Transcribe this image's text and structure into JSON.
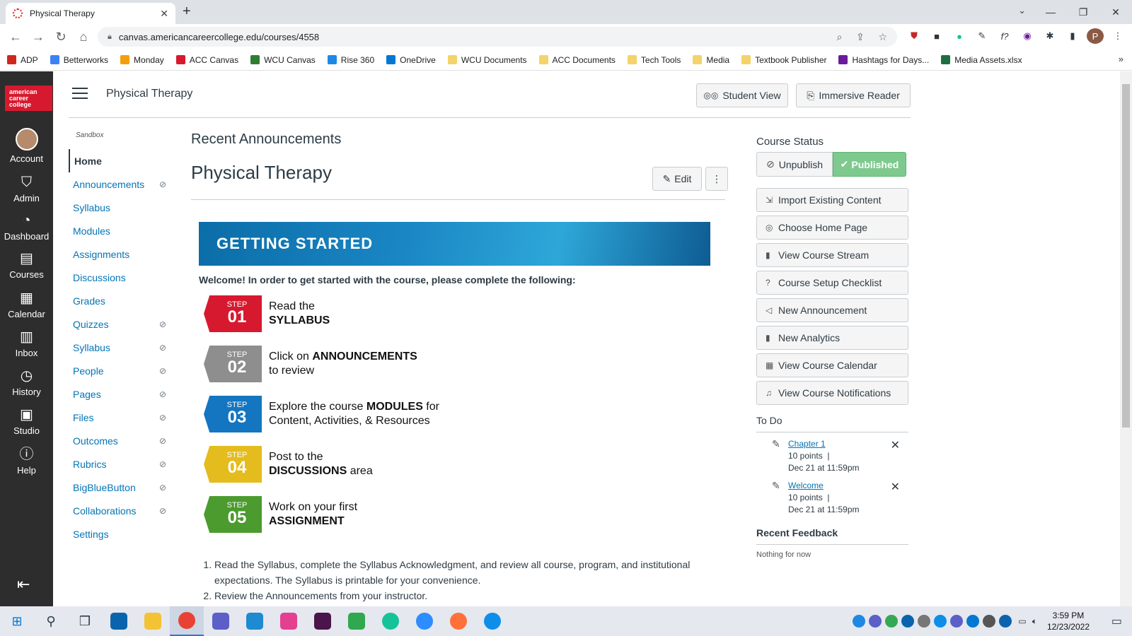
{
  "browser": {
    "tab_title": "Physical Therapy",
    "url": "canvas.americancareercollege.edu/courses/4558",
    "profile_initial": "P",
    "bookmarks": [
      {
        "label": "ADP",
        "color": "#d0271d"
      },
      {
        "label": "Betterworks",
        "color": "#3b82f6"
      },
      {
        "label": "Monday",
        "color": "#f59e0b"
      },
      {
        "label": "ACC Canvas",
        "color": "#d7192f"
      },
      {
        "label": "WCU Canvas",
        "color": "#2e7d32"
      },
      {
        "label": "Rise 360",
        "color": "#1e88e5"
      },
      {
        "label": "OneDrive",
        "color": "#0078d4"
      },
      {
        "label": "WCU Documents",
        "color": "#f3d36a"
      },
      {
        "label": "ACC Documents",
        "color": "#f3d36a"
      },
      {
        "label": "Tech Tools",
        "color": "#f3d36a"
      },
      {
        "label": "Media",
        "color": "#f3d36a"
      },
      {
        "label": "Textbook Publisher",
        "color": "#f3d36a"
      },
      {
        "label": "Hashtags for Days...",
        "color": "#6a1b9a"
      },
      {
        "label": "Media Assets.xlsx",
        "color": "#1d6f42"
      }
    ]
  },
  "global_nav": {
    "logo": "american career college",
    "items": [
      {
        "label": "Account",
        "icon": "avatar"
      },
      {
        "label": "Admin",
        "icon": "shield-icon"
      },
      {
        "label": "Dashboard",
        "icon": "dashboard-icon"
      },
      {
        "label": "Courses",
        "icon": "book-icon"
      },
      {
        "label": "Calendar",
        "icon": "calendar-icon"
      },
      {
        "label": "Inbox",
        "icon": "inbox-icon"
      },
      {
        "label": "History",
        "icon": "clock-icon"
      },
      {
        "label": "Studio",
        "icon": "studio-icon"
      },
      {
        "label": "Help",
        "icon": "help-icon"
      }
    ]
  },
  "header": {
    "breadcrumb": "Physical Therapy",
    "student_view": "Student View",
    "immersive_reader": "Immersive Reader"
  },
  "course_nav": {
    "sandbox": "Sandbox",
    "items": [
      {
        "label": "Home",
        "hidden": false
      },
      {
        "label": "Announcements",
        "hidden": true
      },
      {
        "label": "Syllabus",
        "hidden": false
      },
      {
        "label": "Modules",
        "hidden": false
      },
      {
        "label": "Assignments",
        "hidden": false
      },
      {
        "label": "Discussions",
        "hidden": false
      },
      {
        "label": "Grades",
        "hidden": false
      },
      {
        "label": "Quizzes",
        "hidden": true
      },
      {
        "label": "Syllabus",
        "hidden": true
      },
      {
        "label": "People",
        "hidden": true
      },
      {
        "label": "Pages",
        "hidden": true
      },
      {
        "label": "Files",
        "hidden": true
      },
      {
        "label": "Outcomes",
        "hidden": true
      },
      {
        "label": "Rubrics",
        "hidden": true
      },
      {
        "label": "BigBlueButton",
        "hidden": true
      },
      {
        "label": "Collaborations",
        "hidden": true
      },
      {
        "label": "Settings",
        "hidden": false
      }
    ]
  },
  "main": {
    "recent_announcements": "Recent Announcements",
    "page_title": "Physical Therapy",
    "edit_label": "Edit",
    "banner_title": "GETTING STARTED",
    "welcome": "Welcome! In order to get started with the course, please complete the following:",
    "steps": [
      {
        "label": "STEP",
        "num": "01",
        "color": "#d7192f",
        "line1": "Read the",
        "line1_bold": "",
        "line2": "",
        "line2_bold": "SYLLABUS"
      },
      {
        "label": "STEP",
        "num": "02",
        "color": "#8e8e8e",
        "line1": "Click on ",
        "line1_bold": "ANNOUNCEMENTS",
        "line2": "to review",
        "line2_bold": ""
      },
      {
        "label": "STEP",
        "num": "03",
        "color": "#1476c1",
        "line1": "Explore the course ",
        "line1_bold": "MODULES",
        "line1_tail": " for",
        "line2": "Content, Activities, & Resources",
        "line2_bold": ""
      },
      {
        "label": "STEP",
        "num": "04",
        "color": "#e4bc1d",
        "line1": "Post to the",
        "line1_bold": "",
        "line2": " area",
        "line2_bold": "DISCUSSIONS"
      },
      {
        "label": "STEP",
        "num": "05",
        "color": "#4b9b2e",
        "line1": "Work on your first",
        "line1_bold": "",
        "line2": "",
        "line2_bold": "ASSIGNMENT"
      }
    ],
    "instructions": [
      "Read the Syllabus, complete the Syllabus Acknowledgment, and review all course, program, and institutional expectations. The Syllabus is printable for your convenience.",
      "Review the Announcements from your instructor."
    ]
  },
  "sidebar": {
    "course_status": "Course Status",
    "unpublish": "Unpublish",
    "published": "Published",
    "buttons": [
      {
        "label": "Import Existing Content",
        "icon": "import-icon"
      },
      {
        "label": "Choose Home Page",
        "icon": "target-icon"
      },
      {
        "label": "View Course Stream",
        "icon": "bar-chart-icon"
      },
      {
        "label": "Course Setup Checklist",
        "icon": "question-icon"
      },
      {
        "label": "New Announcement",
        "icon": "megaphone-icon"
      },
      {
        "label": "New Analytics",
        "icon": "bar-chart-icon"
      },
      {
        "label": "View Course Calendar",
        "icon": "calendar-icon"
      },
      {
        "label": "View Course Notifications",
        "icon": "bell-icon"
      }
    ],
    "todo_title": "To Do",
    "todo": [
      {
        "title": "Chapter 1",
        "points": "10 points",
        "sep": "|",
        "due": "Dec 21 at 11:59pm"
      },
      {
        "title": "Welcome",
        "points": "10 points",
        "sep": "|",
        "due": "Dec 21 at 11:59pm"
      }
    ],
    "feedback_title": "Recent Feedback",
    "feedback_empty": "Nothing for now"
  },
  "taskbar": {
    "time": "3:59 PM",
    "date": "12/23/2022"
  }
}
